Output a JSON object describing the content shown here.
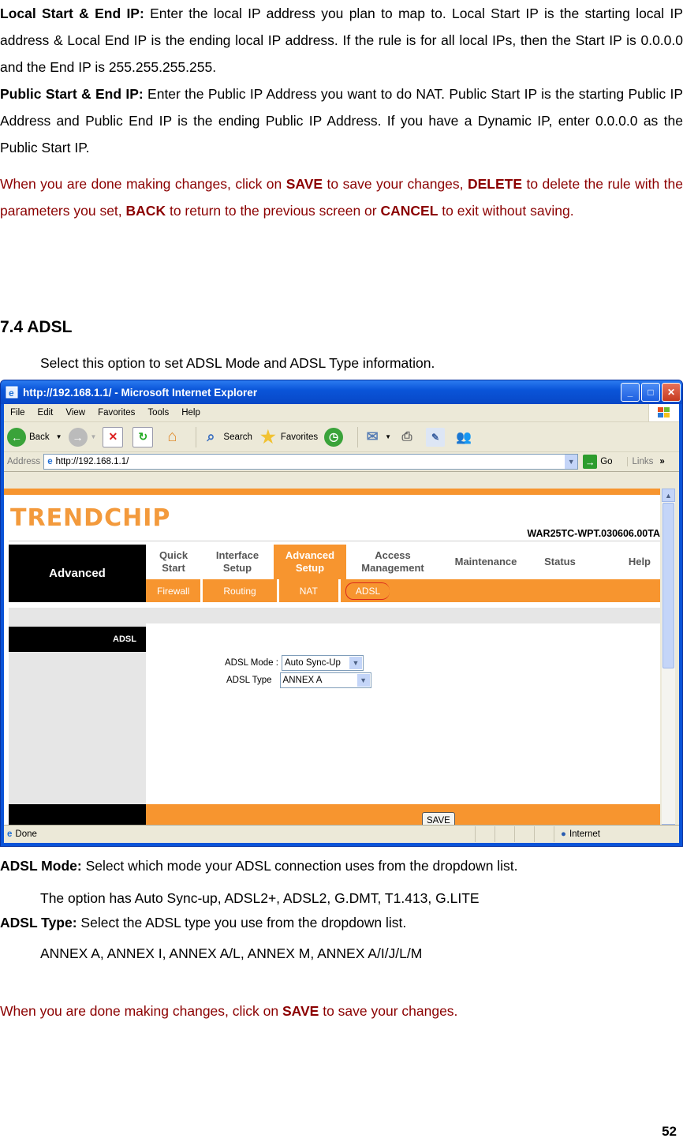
{
  "doc": {
    "local_ip": {
      "label": "Local Start & End IP:",
      "text": " Enter the local IP address you plan to map to. Local Start IP is the starting local IP address & Local End IP is the ending local IP address. If the rule is for all local IPs, then the Start IP is 0.0.0.0 and the End IP is 255.255.255.255."
    },
    "public_ip": {
      "label": "Public Start & End IP:",
      "text": " Enter the Public IP Address you want to do NAT. Public Start IP is the starting Public IP Address and Public End IP is the ending Public IP Address. If you have a Dynamic IP, enter 0.0.0.0 as the Public Start IP."
    },
    "note1": {
      "t1": "When you are done making changes, click on ",
      "save": "SAVE",
      "t2": " to save your changes, ",
      "delete": "DELETE",
      "t3": " to delete the rule with the parameters you set, ",
      "back": "BACK",
      "t4": " to return to the previous screen or ",
      "cancel": "CANCEL",
      "t5": " to exit without saving."
    },
    "section_title": "7.4 ADSL",
    "section_intro": "Select this option to set ADSL Mode and ADSL Type information.",
    "adsl_mode": {
      "label": "ADSL Mode:",
      "text": " Select which mode your ADSL connection uses from the dropdown list.",
      "options_text": "The option has Auto Sync-up, ADSL2+, ADSL2, G.DMT, T1.413, G.LITE"
    },
    "adsl_type": {
      "label": "ADSL Type:",
      "text": " Select the ADSL type you use from the dropdown list.",
      "options_text": "ANNEX A, ANNEX I, ANNEX A/L, ANNEX M, ANNEX A/I/J/L/M"
    },
    "note2": {
      "t1": "When you are done making changes, click on ",
      "save": "SAVE",
      "t2": " to save your changes."
    },
    "page_number": "52"
  },
  "browser": {
    "title": "http://192.168.1.1/ - Microsoft Internet Explorer",
    "menu": [
      "File",
      "Edit",
      "View",
      "Favorites",
      "Tools",
      "Help"
    ],
    "toolbar": {
      "back": "Back",
      "search": "Search",
      "favorites": "Favorites"
    },
    "address_label": "Address",
    "address_value": "http://192.168.1.1/",
    "go": "Go",
    "links": "Links",
    "status": "Done",
    "zone": "Internet"
  },
  "router": {
    "logo": "TRENDCHIP",
    "firmware": "WAR25TC-WPT.030606.00TA",
    "section": "Advanced",
    "tabs": [
      {
        "l1": "Quick",
        "l2": "Start"
      },
      {
        "l1": "Interface",
        "l2": "Setup"
      },
      {
        "l1": "Advanced",
        "l2": "Setup"
      },
      {
        "l1": "Access",
        "l2": "Management"
      },
      {
        "l1": "Maintenance",
        "l2": ""
      },
      {
        "l1": "Status",
        "l2": ""
      },
      {
        "l1": "Help",
        "l2": ""
      }
    ],
    "subtabs": [
      "Firewall",
      "Routing",
      "NAT",
      "ADSL"
    ],
    "left_label": "ADSL",
    "mode_label": "ADSL Mode :",
    "mode_value": "Auto Sync-Up",
    "type_label": "ADSL Type",
    "type_value": "ANNEX A",
    "save": "SAVE"
  },
  "colors": {
    "accent_orange": "#f7952f",
    "note_red": "#8b0000",
    "xp_blue": "#0a53d8"
  }
}
